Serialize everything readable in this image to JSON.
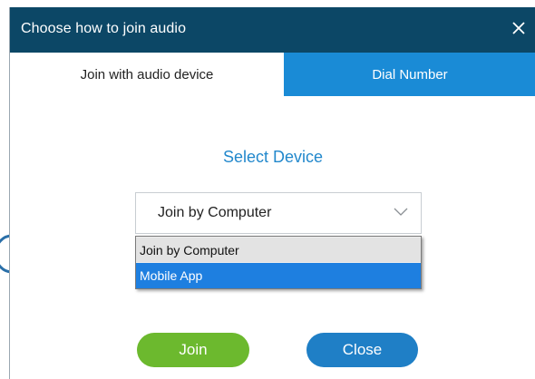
{
  "dialog": {
    "title": "Choose how to join audio",
    "close_icon": "close-icon"
  },
  "tabs": [
    {
      "label": "Join with audio device",
      "active": true
    },
    {
      "label": "Dial Number",
      "active": false
    }
  ],
  "main": {
    "heading": "Select Device",
    "device_select": {
      "selected": "Join by Computer",
      "options": [
        "Join by Computer",
        "Mobile App"
      ],
      "highlighted": "Mobile App"
    }
  },
  "buttons": {
    "join": "Join",
    "close": "Close"
  },
  "colors": {
    "titlebar": "#0c4766",
    "tab_inactive": "#1a8bd6",
    "heading": "#2288cc",
    "join_button": "#6cb92e",
    "close_button": "#1f7fc6",
    "highlight": "#1e7fe0"
  }
}
